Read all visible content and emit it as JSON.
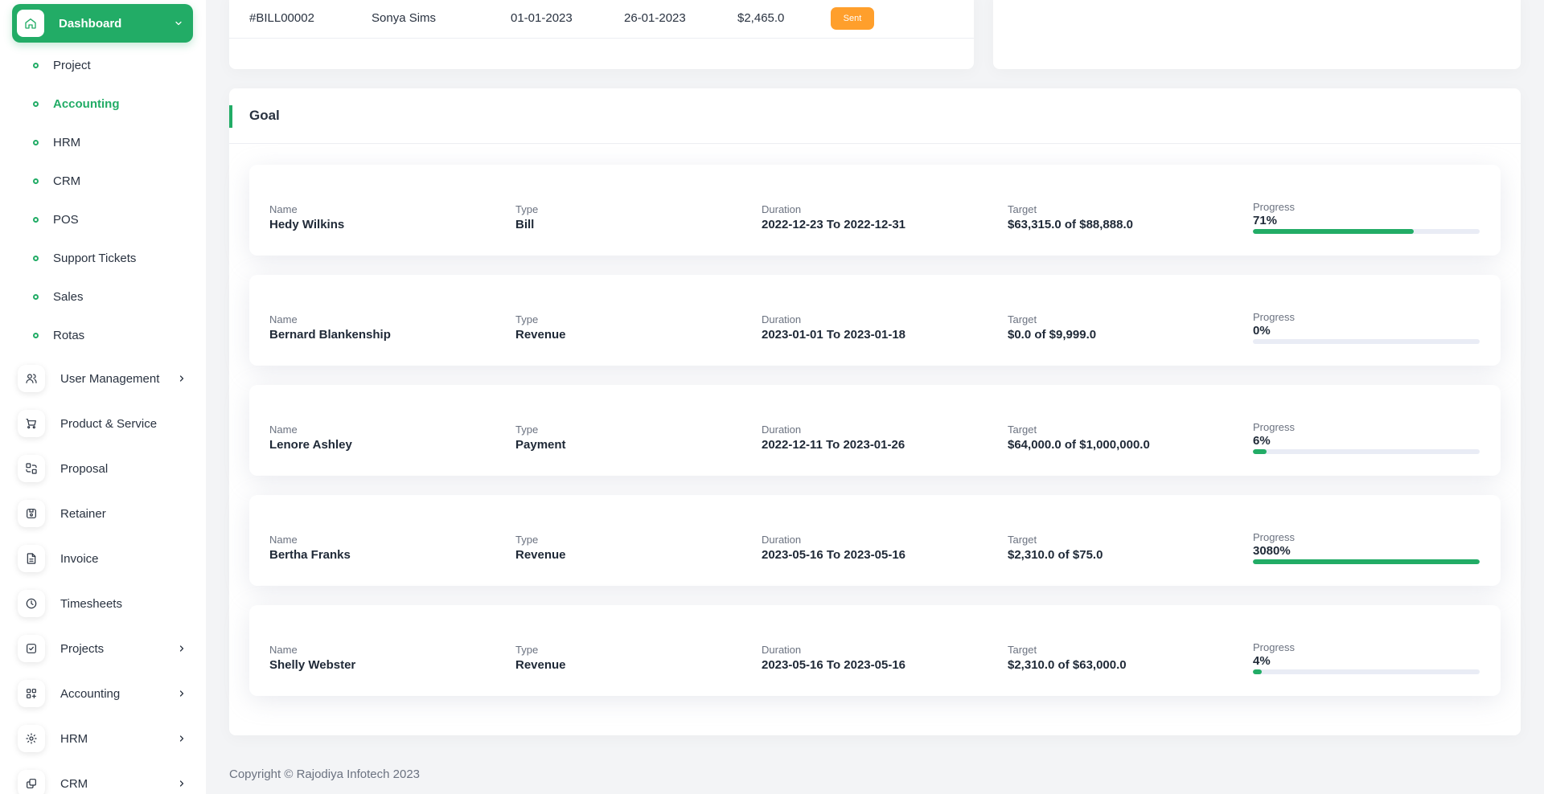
{
  "sidebar": {
    "dashboard": {
      "label": "Dashboard",
      "icon": "home-icon"
    },
    "subitems": [
      {
        "label": "Project",
        "active": false
      },
      {
        "label": "Accounting",
        "active": true
      },
      {
        "label": "HRM",
        "active": false
      },
      {
        "label": "CRM",
        "active": false
      },
      {
        "label": "POS",
        "active": false
      },
      {
        "label": "Support Tickets",
        "active": false
      },
      {
        "label": "Sales",
        "active": false
      },
      {
        "label": "Rotas",
        "active": false
      }
    ],
    "items": [
      {
        "label": "User Management",
        "icon": "users-icon",
        "has_submenu": true
      },
      {
        "label": "Product & Service",
        "icon": "cart-icon",
        "has_submenu": false
      },
      {
        "label": "Proposal",
        "icon": "proposal-icon",
        "has_submenu": false
      },
      {
        "label": "Retainer",
        "icon": "retainer-icon",
        "has_submenu": false
      },
      {
        "label": "Invoice",
        "icon": "invoice-icon",
        "has_submenu": false
      },
      {
        "label": "Timesheets",
        "icon": "clock-icon",
        "has_submenu": false
      },
      {
        "label": "Projects",
        "icon": "checkbox-icon",
        "has_submenu": true
      },
      {
        "label": "Accounting",
        "icon": "apps-icon",
        "has_submenu": true
      },
      {
        "label": "HRM",
        "icon": "hrm-icon",
        "has_submenu": true
      },
      {
        "label": "CRM",
        "icon": "crm-icon",
        "has_submenu": true
      }
    ]
  },
  "bill": {
    "number": "#BILL00002",
    "vendor": "Sonya Sims",
    "bill_date": "01-01-2023",
    "due_date": "26-01-2023",
    "amount": "$2,465.0",
    "status": "Sent"
  },
  "goal": {
    "title": "Goal",
    "labels": {
      "name": "Name",
      "type": "Type",
      "duration": "Duration",
      "target": "Target",
      "progress": "Progress"
    },
    "items": [
      {
        "name": "Hedy Wilkins",
        "type": "Bill",
        "duration": "2022-12-23 To 2022-12-31",
        "target": "$63,315.0 of $88,888.0",
        "progress_text": "71%",
        "progress": 71
      },
      {
        "name": "Bernard Blankenship",
        "type": "Revenue",
        "duration": "2023-01-01 To 2023-01-18",
        "target": "$0.0 of $9,999.0",
        "progress_text": "0%",
        "progress": 0
      },
      {
        "name": "Lenore Ashley",
        "type": "Payment",
        "duration": "2022-12-11 To 2023-01-26",
        "target": "$64,000.0 of $1,000,000.0",
        "progress_text": "6%",
        "progress": 6
      },
      {
        "name": "Bertha Franks",
        "type": "Revenue",
        "duration": "2023-05-16 To 2023-05-16",
        "target": "$2,310.0 of $75.0",
        "progress_text": "3080%",
        "progress": 100
      },
      {
        "name": "Shelly Webster",
        "type": "Revenue",
        "duration": "2023-05-16 To 2023-05-16",
        "target": "$2,310.0 of $63,000.0",
        "progress_text": "4%",
        "progress": 4
      }
    ]
  },
  "footer": {
    "copyright": "Copyright © Rajodiya Infotech 2023"
  },
  "colors": {
    "accent": "#22ac66",
    "badge": "#ff9f2c",
    "track": "#e9ecf5"
  }
}
